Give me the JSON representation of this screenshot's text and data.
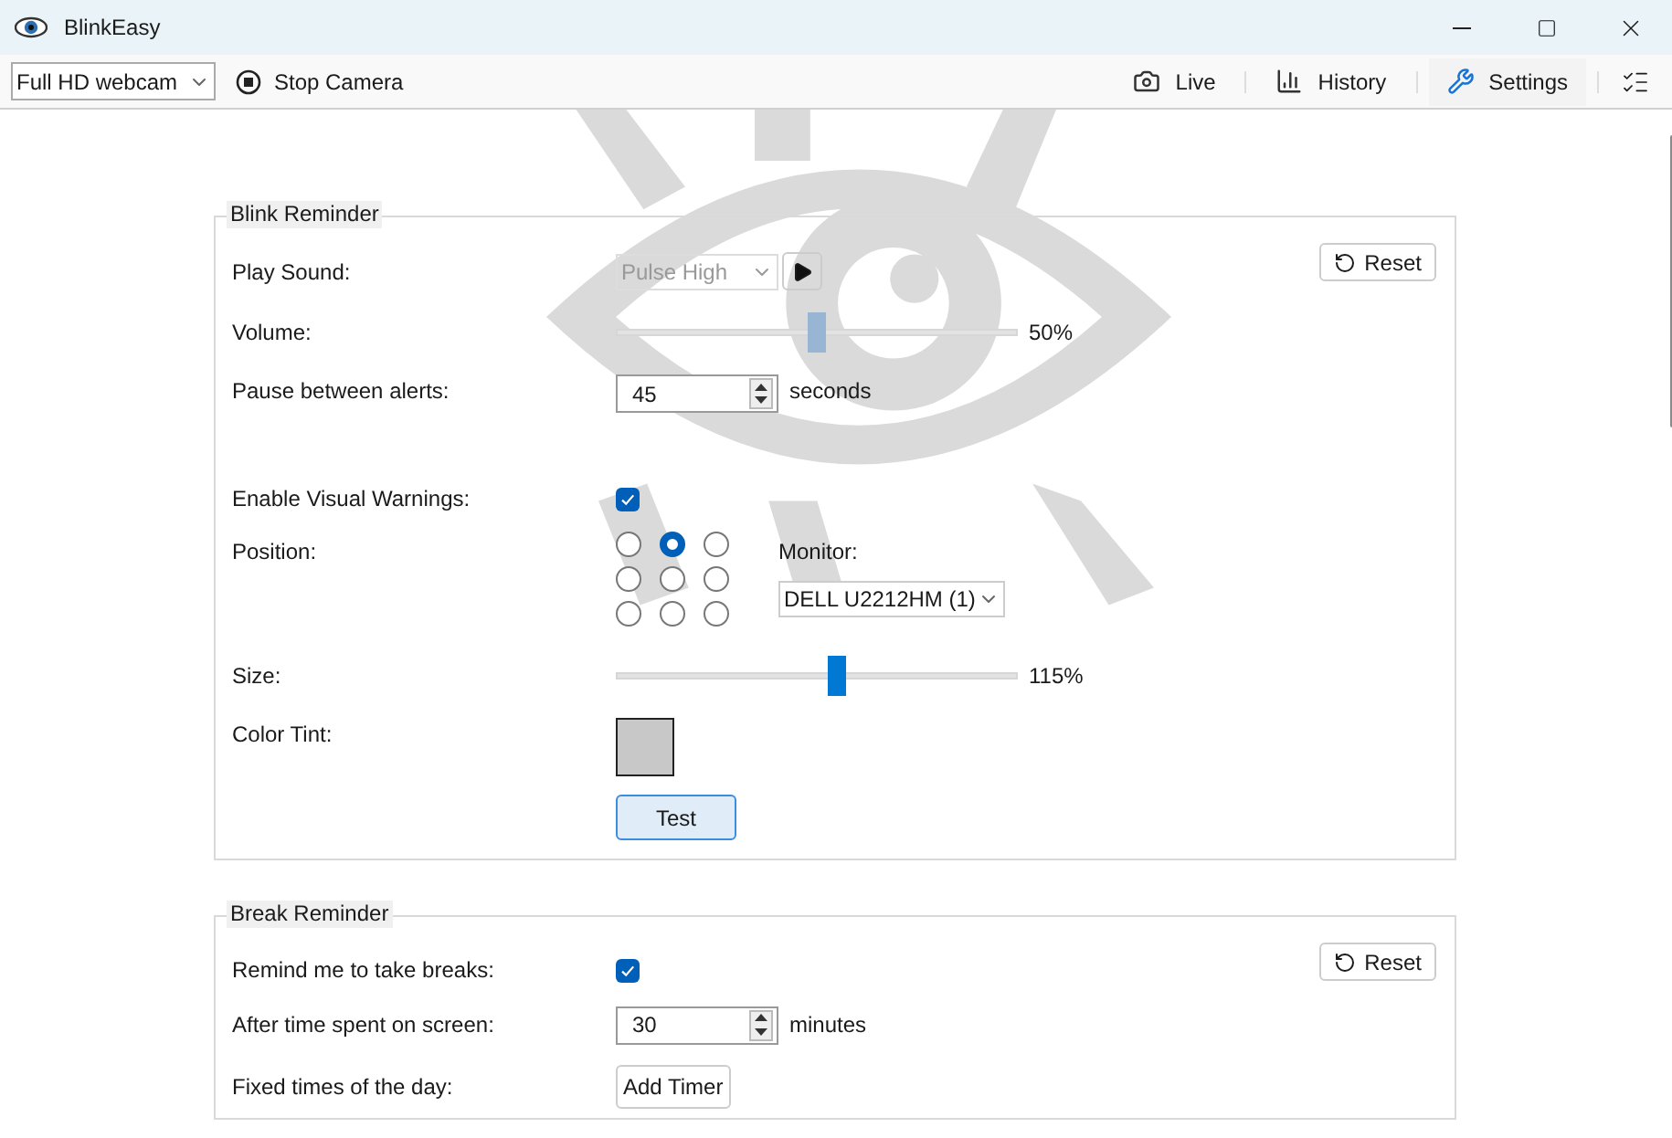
{
  "window": {
    "title": "BlinkEasy"
  },
  "toolbar": {
    "camera": {
      "value": "Full HD webcam"
    },
    "stop_button": "Stop Camera",
    "tabs": [
      {
        "label": "Live",
        "kind": "camera",
        "selected": false
      },
      {
        "label": "History",
        "kind": "chart",
        "selected": false
      },
      {
        "label": "Settings",
        "kind": "wrench",
        "selected": true
      }
    ]
  },
  "blink_reminder": {
    "title": "Blink Reminder",
    "reset": "Reset",
    "play_sound": {
      "label": "Play Sound:",
      "value": "Pulse High",
      "disabled": true
    },
    "volume": {
      "label": "Volume:",
      "level": 0.5,
      "reading": "50%",
      "disabled": true
    },
    "pause": {
      "label": "Pause between alerts:",
      "value": "45",
      "unit": "seconds"
    },
    "visual_warnings": {
      "label": "Enable Visual Warnings:",
      "checked": true
    },
    "position": {
      "label": "Position:",
      "options": [
        {
          "selected": false
        },
        {
          "selected": true
        },
        {
          "selected": false
        },
        {
          "selected": false
        },
        {
          "selected": false
        },
        {
          "selected": false
        },
        {
          "selected": false
        },
        {
          "selected": false
        },
        {
          "selected": false
        }
      ]
    },
    "monitor": {
      "label": "Monitor:",
      "value": "DELL U2212HM (1)"
    },
    "size": {
      "label": "Size:",
      "level": 0.55,
      "reading": "115%",
      "disabled": false
    },
    "color_tint": {
      "label": "Color Tint:",
      "color": "#c8c8c8"
    },
    "test_button": "Test"
  },
  "break_reminder": {
    "title": "Break Reminder",
    "reset": "Reset",
    "remind": {
      "label": "Remind me to take breaks:",
      "checked": true
    },
    "after_time": {
      "label": "After time spent on screen:",
      "value": "30",
      "unit": "minutes"
    },
    "fixed_times": {
      "label": "Fixed times of the day:",
      "button": "Add Timer"
    }
  }
}
